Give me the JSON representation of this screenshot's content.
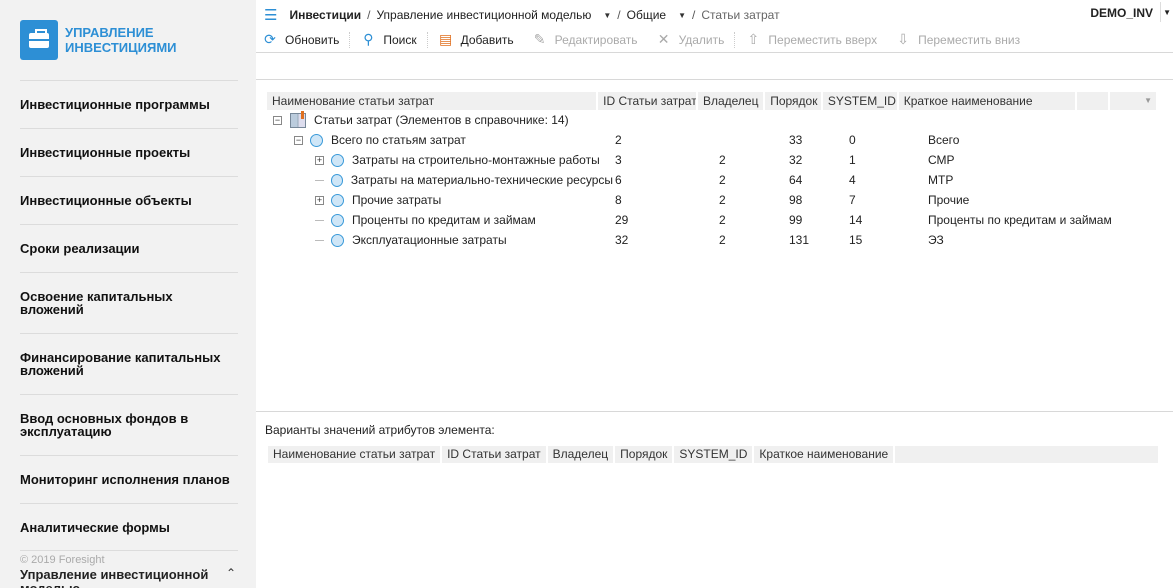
{
  "sidebar": {
    "logo_line1": "УПРАВЛЕНИЕ",
    "logo_line2": "ИНВЕСТИЦИЯМИ",
    "items": [
      {
        "label": "Инвестиционные программы"
      },
      {
        "label": "Инвестиционные проекты"
      },
      {
        "label": "Инвестиционные объекты"
      },
      {
        "label": "Сроки реализации"
      },
      {
        "label": "Освоение капитальных вложений"
      },
      {
        "label": "Финансирование капитальных вложений"
      },
      {
        "label": "Ввод основных фондов в эксплуатацию"
      },
      {
        "label": "Мониторинг исполнения планов"
      },
      {
        "label": "Аналитические формы"
      }
    ],
    "copyright": "© 2019 Foresight",
    "current_section": "Управление инвестиционной моделью"
  },
  "breadcrumb": {
    "root": "Инвестиции",
    "b1": "Управление инвестиционной моделью",
    "b2": "Общие",
    "current": "Статьи затрат",
    "sep": "/"
  },
  "user": "DEMO_INV",
  "toolbar": {
    "refresh": "Обновить",
    "search": "Поиск",
    "add": "Добавить",
    "edit": "Редактировать",
    "delete": "Удалить",
    "move_up": "Переместить вверх",
    "move_down": "Переместить вниз"
  },
  "grid": {
    "columns": [
      "Наименование статьи затрат",
      "ID Статьи затрат",
      "Владелец",
      "Порядок",
      "SYSTEM_ID",
      "Краткое наименование"
    ],
    "root": "Статьи затрат (Элементов в справочнике: 14)",
    "rows": [
      {
        "name": "Всего по статьям затрат",
        "id": "2",
        "owner": "",
        "order": "33",
        "system_id": "0",
        "short": "Всего"
      },
      {
        "name": "Затраты на строительно-монтажные работы",
        "id": "3",
        "owner": "2",
        "order": "32",
        "system_id": "1",
        "short": "СМР"
      },
      {
        "name": "Затраты на материально-технические ресурсы",
        "id": "6",
        "owner": "2",
        "order": "64",
        "system_id": "4",
        "short": "МТР"
      },
      {
        "name": "Прочие затраты",
        "id": "8",
        "owner": "2",
        "order": "98",
        "system_id": "7",
        "short": "Прочие"
      },
      {
        "name": "Проценты по кредитам и займам",
        "id": "29",
        "owner": "2",
        "order": "99",
        "system_id": "14",
        "short": "Проценты по кредитам и займам"
      },
      {
        "name": "Эксплуатационные затраты",
        "id": "32",
        "owner": "2",
        "order": "131",
        "system_id": "15",
        "short": "ЭЗ"
      }
    ]
  },
  "attributes": {
    "label": "Варианты значений атрибутов элемента:",
    "columns": [
      "Наименование статьи затрат",
      "ID Статьи затрат",
      "Владелец",
      "Порядок",
      "SYSTEM_ID",
      "Краткое наименование"
    ]
  }
}
